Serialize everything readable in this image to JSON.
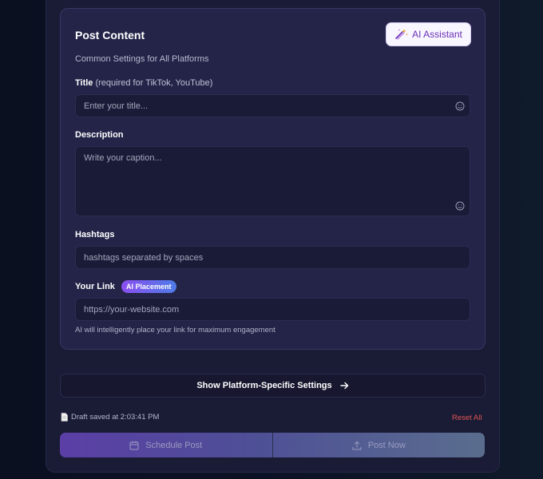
{
  "post_content": {
    "title": "Post Content",
    "ai_assistant_label": "AI Assistant",
    "subtitle": "Common Settings for All Platforms"
  },
  "title_field": {
    "label": "Title",
    "hint": "(required for TikTok, YouTube)",
    "placeholder": "Enter your title...",
    "value": ""
  },
  "description_field": {
    "label": "Description",
    "placeholder": "Write your caption...",
    "value": ""
  },
  "hashtags_field": {
    "label": "Hashtags",
    "placeholder": "hashtags separated by spaces",
    "value": ""
  },
  "link_field": {
    "label": "Your Link",
    "badge": "AI Placement",
    "placeholder": "https://your-website.com",
    "value": "",
    "helper": "AI will intelligently place your link for maximum engagement"
  },
  "platform_settings": {
    "label": "Show Platform-Specific Settings"
  },
  "footer": {
    "draft_status": "Draft saved at 2:03:41 PM",
    "reset_label": "Reset All",
    "schedule_label": "Schedule Post",
    "post_now_label": "Post Now"
  },
  "colors": {
    "accent_purple": "#6b2fb5",
    "reset_red": "#e05555",
    "card_bg": "#232448"
  },
  "icons": [
    "magic-wand-icon",
    "emoji-icon",
    "arrow-right-icon",
    "document-icon",
    "calendar-icon",
    "upload-icon"
  ]
}
